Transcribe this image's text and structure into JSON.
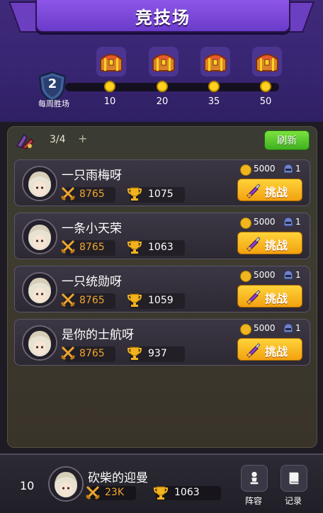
{
  "header": {
    "title": "竞技场",
    "weekly_wins": "2",
    "weekly_wins_label": "每周胜场",
    "milestones": [
      "10",
      "20",
      "35",
      "50"
    ]
  },
  "tickets": {
    "count": "3/4",
    "plus": "+"
  },
  "refresh_label": "刷新",
  "opponents": [
    {
      "name": "一只雨梅呀",
      "power": "8765",
      "trophies": "1075",
      "cost": "5000",
      "count": "1",
      "challenge": "挑战"
    },
    {
      "name": "一条小天荣",
      "power": "8765",
      "trophies": "1063",
      "cost": "5000",
      "count": "1",
      "challenge": "挑战"
    },
    {
      "name": "一只统勋呀",
      "power": "8765",
      "trophies": "1059",
      "cost": "5000",
      "count": "1",
      "challenge": "挑战"
    },
    {
      "name": "是你的士航呀",
      "power": "8765",
      "trophies": "937",
      "cost": "5000",
      "count": "1",
      "challenge": "挑战"
    }
  ],
  "me": {
    "rank": "10",
    "name": "砍柴的迎曼",
    "power": "23K",
    "trophies": "1063"
  },
  "bottom_buttons": {
    "lineup": "阵容",
    "record": "记录"
  },
  "colors": {
    "header": "#372571",
    "banner": "#7a47d6",
    "gold": "#ffd21f",
    "refresh": "#4fc22a",
    "challenge": "#f7b21e"
  }
}
